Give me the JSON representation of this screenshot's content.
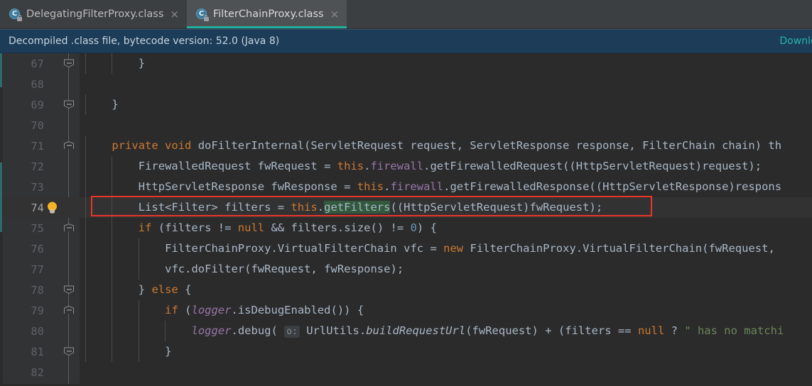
{
  "window": {
    "theme_bg": "#2b2b2b",
    "accent": "#20b0a0",
    "annotation_color": "#e8352b"
  },
  "tabs": [
    {
      "label": "DelegatingFilterProxy.class",
      "icon": "java-class-locked-icon",
      "close": "×",
      "active": false,
      "badge": "C"
    },
    {
      "label": "FilterChainProxy.class",
      "icon": "java-class-locked-icon",
      "close": "×",
      "active": true,
      "badge": "C"
    }
  ],
  "banner": {
    "message": "Decompiled .class file, bytecode version: 52.0 (Java 8)",
    "link": "Download"
  },
  "gutter": {
    "lines": [
      {
        "number": "67",
        "fold": "end",
        "bulb": false,
        "current": false
      },
      {
        "number": "68",
        "fold": "none",
        "bulb": false,
        "current": false
      },
      {
        "number": "69",
        "fold": "end",
        "bulb": false,
        "current": false
      },
      {
        "number": "70",
        "fold": "none",
        "bulb": false,
        "current": false
      },
      {
        "number": "71",
        "fold": "start",
        "bulb": false,
        "current": false
      },
      {
        "number": "72",
        "fold": "none",
        "bulb": false,
        "current": false
      },
      {
        "number": "73",
        "fold": "none",
        "bulb": false,
        "current": false
      },
      {
        "number": "74",
        "fold": "none",
        "bulb": true,
        "current": true
      },
      {
        "number": "75",
        "fold": "start",
        "bulb": false,
        "current": false
      },
      {
        "number": "76",
        "fold": "none",
        "bulb": false,
        "current": false
      },
      {
        "number": "77",
        "fold": "none",
        "bulb": false,
        "current": false
      },
      {
        "number": "78",
        "fold": "end",
        "bulb": false,
        "current": false
      },
      {
        "number": "79",
        "fold": "start",
        "bulb": false,
        "current": false
      },
      {
        "number": "80",
        "fold": "none",
        "bulb": false,
        "current": false
      },
      {
        "number": "81",
        "fold": "end",
        "bulb": false,
        "current": false
      },
      {
        "number": "82",
        "fold": "none",
        "bulb": false,
        "current": false
      }
    ]
  },
  "code": {
    "lines": [
      "        }",
      "",
      "    }",
      "",
      "    private void doFilterInternal(ServletRequest request, ServletResponse response, FilterChain chain) th",
      "        FirewalledRequest fwRequest = this.firewall.getFirewalledRequest((HttpServletRequest)request);",
      "        HttpServletResponse fwResponse = this.firewall.getFirewalledResponse((HttpServletResponse)respons",
      "        List<Filter> filters = this.getFilters((HttpServletRequest)fwRequest);",
      "        if (filters != null && filters.size() != 0) {",
      "            FilterChainProxy.VirtualFilterChain vfc = new FilterChainProxy.VirtualFilterChain(fwRequest,",
      "            vfc.doFilter(fwRequest, fwResponse);",
      "        } else {",
      "            if (logger.isDebugEnabled()) {",
      "                logger.debug( o: UrlUtils.buildRequestUrl(fwRequest) + (filters == null ? \" has no matchi",
      "            }",
      ""
    ],
    "highlighted_symbol": "getFilters",
    "parameter_hint": "o:"
  }
}
